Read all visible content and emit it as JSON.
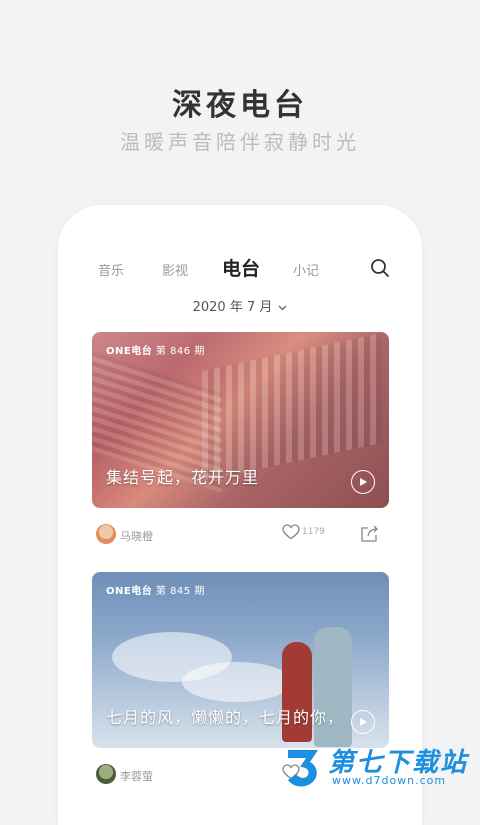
{
  "hero": {
    "title": "深夜电台",
    "subtitle": "温暖声音陪伴寂静时光"
  },
  "nav": {
    "tabs": [
      {
        "label": "音乐",
        "active": false
      },
      {
        "label": "影视",
        "active": false
      },
      {
        "label": "电台",
        "active": true
      },
      {
        "label": "小记",
        "active": false
      },
      {
        "label": "'",
        "active": false
      }
    ],
    "search_icon": "search-icon"
  },
  "date_picker": {
    "label": "2020 年 7 月"
  },
  "posts": [
    {
      "brand": "ONE电台",
      "issue": "第 846 期",
      "title": "集结号起，花开万里",
      "author": "马晓橙",
      "likes": "1179"
    },
    {
      "brand": "ONE电台",
      "issue": "第 845 期",
      "title": "七月的风，懒懒的，七月的你，",
      "author": "李蓉萤",
      "likes": ""
    }
  ],
  "watermark": {
    "name": "第七下载站",
    "url": "www.d7down.com"
  },
  "colors": {
    "accent": "#1c8fe0",
    "background": "#f3f3f3"
  }
}
